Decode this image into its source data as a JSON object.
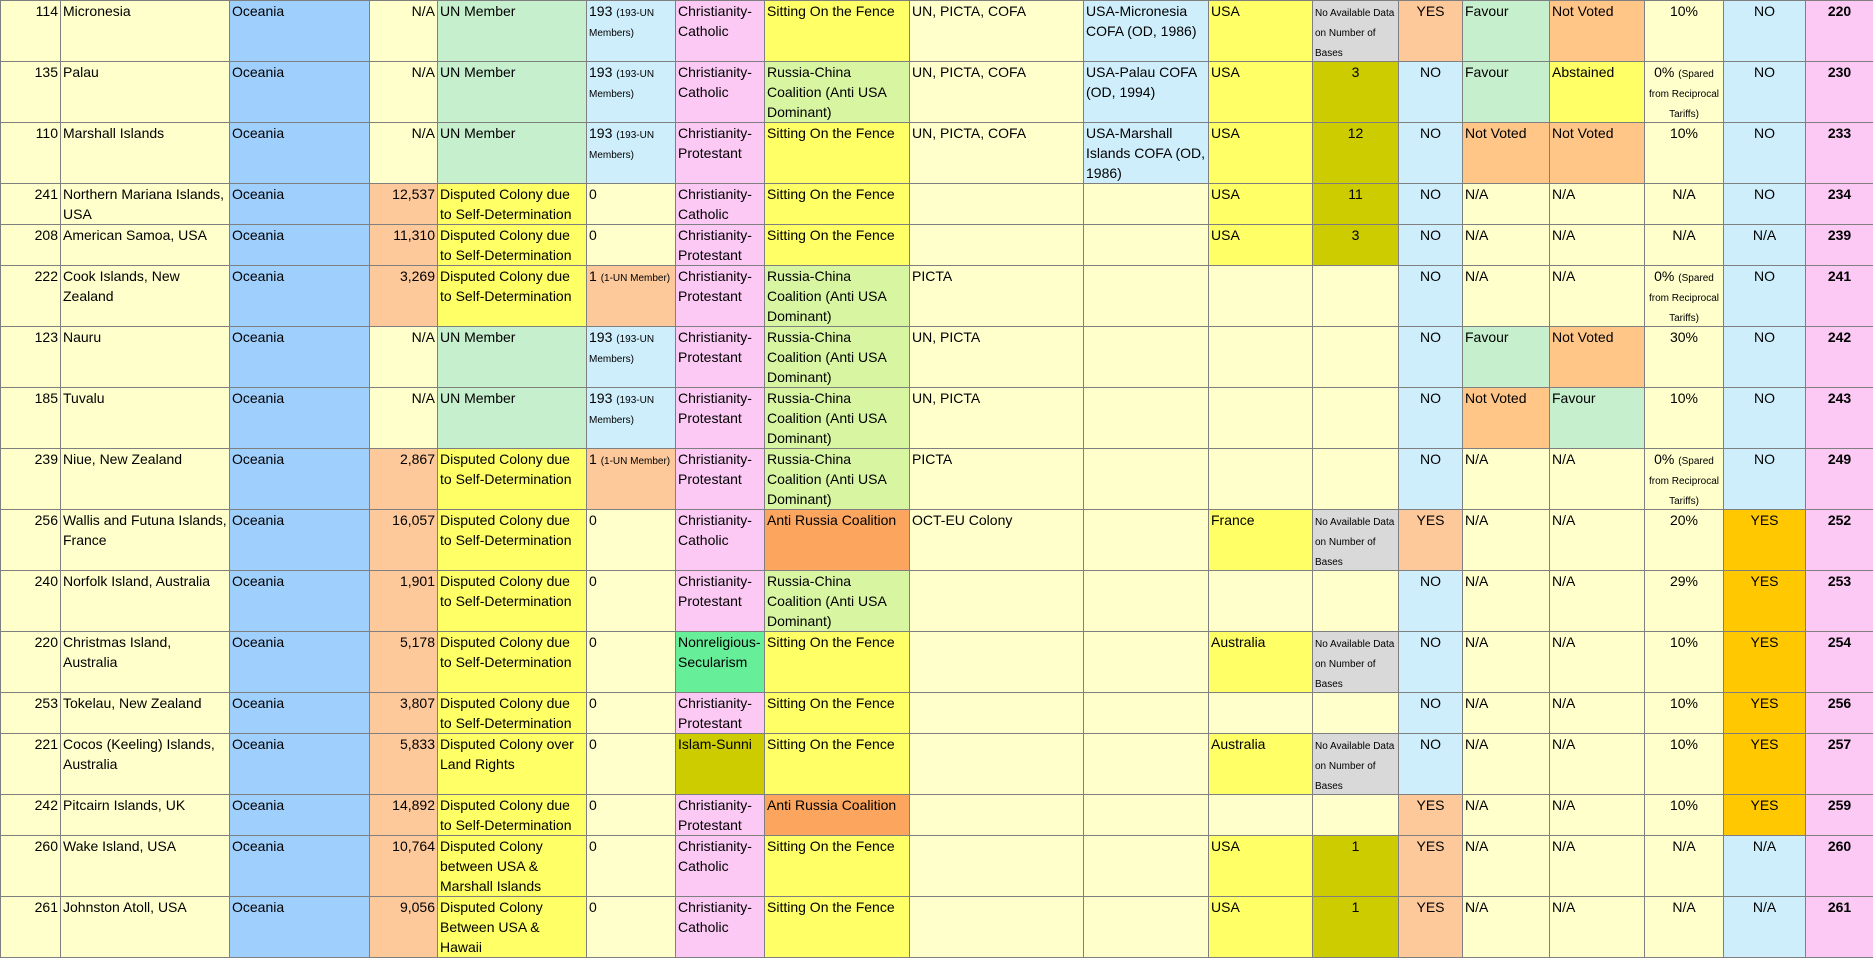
{
  "colors": {
    "pale_yellow": "#ffffcc",
    "region_blue": "#9fcffc",
    "peach": "#fdc99b",
    "green": "#c6efce",
    "light_blue": "#cfeefc",
    "pink": "#fcc9f5",
    "yellow": "#ffff66",
    "lime": "#d8f5a2",
    "orange": "#fba55f",
    "olive": "#cccc00",
    "mint": "#66ee99",
    "gray": "#d9d9d9",
    "gold": "#ffc800",
    "light_orange": "#ffc688"
  },
  "rows": [
    {
      "rank": "114",
      "name": "Micronesia",
      "region": "Oceania",
      "population": "N/A",
      "status": "UN Member",
      "un_count": "193",
      "un_note": "(193-UN Members)",
      "religion": "Christianity-Catholic",
      "alignment": "Sitting On the Fence",
      "orgs": "UN, PICTA, COFA",
      "agreement": "USA-Micronesia COFA (OD, 1986)",
      "host": "USA",
      "bases": "No Available Data on Number of Bases",
      "presence": "YES",
      "vote1": "Favour",
      "vote2": "Not Voted",
      "tariff": "10%",
      "tariff_note": "",
      "flag": "NO",
      "final_rank": "220"
    },
    {
      "rank": "135",
      "name": "Palau",
      "region": "Oceania",
      "population": "N/A",
      "status": "UN Member",
      "un_count": "193",
      "un_note": "(193-UN Members)",
      "religion": "Christianity-Catholic",
      "alignment": "Russia-China Coalition (Anti USA Dominant)",
      "orgs": "UN, PICTA, COFA",
      "agreement": "USA-Palau COFA (OD, 1994)",
      "host": "USA",
      "bases": "3",
      "presence": "NO",
      "vote1": "Favour",
      "vote2": "Abstained",
      "tariff": "0%",
      "tariff_note": "(Spared from Reciprocal Tariffs)",
      "flag": "NO",
      "final_rank": "230"
    },
    {
      "rank": "110",
      "name": "Marshall Islands",
      "region": "Oceania",
      "population": "N/A",
      "status": "UN Member",
      "un_count": "193",
      "un_note": "(193-UN Members)",
      "religion": "Christianity-Protestant",
      "alignment": "Sitting On the Fence",
      "orgs": "UN, PICTA, COFA",
      "agreement": "USA-Marshall Islands COFA (OD, 1986)",
      "host": "USA",
      "bases": "12",
      "presence": "NO",
      "vote1": "Not Voted",
      "vote2": "Not Voted",
      "tariff": "10%",
      "tariff_note": "",
      "flag": "NO",
      "final_rank": "233"
    },
    {
      "rank": "241",
      "name": "Northern Mariana Islands, USA",
      "region": "Oceania",
      "population": "12,537",
      "status": "Disputed Colony due to Self-Determination",
      "un_count": "0",
      "un_note": "",
      "religion": "Christianity-Catholic",
      "alignment": "Sitting On the Fence",
      "orgs": "",
      "agreement": "",
      "host": "USA",
      "bases": "11",
      "presence": "NO",
      "vote1": "N/A",
      "vote2": "N/A",
      "tariff": "N/A",
      "tariff_note": "",
      "flag": "NO",
      "final_rank": "234"
    },
    {
      "rank": "208",
      "name": "American Samoa, USA",
      "region": "Oceania",
      "population": "11,310",
      "status": "Disputed Colony due to Self-Determination",
      "un_count": "0",
      "un_note": "",
      "religion": "Christianity-Protestant",
      "alignment": "Sitting On the Fence",
      "orgs": "",
      "agreement": "",
      "host": "USA",
      "bases": "3",
      "presence": "NO",
      "vote1": "N/A",
      "vote2": "N/A",
      "tariff": "N/A",
      "tariff_note": "",
      "flag": "N/A",
      "final_rank": "239"
    },
    {
      "rank": "222",
      "name": "Cook Islands, New Zealand",
      "region": "Oceania",
      "population": "3,269",
      "status": "Disputed Colony due to Self-Determination",
      "un_count": "1",
      "un_note": "(1-UN Member)",
      "religion": "Christianity-Protestant",
      "alignment": "Russia-China Coalition (Anti USA Dominant)",
      "orgs": "PICTA",
      "agreement": "",
      "host": "",
      "bases": "",
      "presence": "NO",
      "vote1": "N/A",
      "vote2": "N/A",
      "tariff": "0%",
      "tariff_note": "(Spared from Reciprocal Tariffs)",
      "flag": "NO",
      "final_rank": "241"
    },
    {
      "rank": "123",
      "name": "Nauru",
      "region": "Oceania",
      "population": "N/A",
      "status": "UN Member",
      "un_count": "193",
      "un_note": "(193-UN Members)",
      "religion": "Christianity-Protestant",
      "alignment": "Russia-China Coalition (Anti USA Dominant)",
      "orgs": "UN, PICTA",
      "agreement": "",
      "host": "",
      "bases": "",
      "presence": "NO",
      "vote1": "Favour",
      "vote2": "Not Voted",
      "tariff": "30%",
      "tariff_note": "",
      "flag": "NO",
      "final_rank": "242"
    },
    {
      "rank": "185",
      "name": "Tuvalu",
      "region": "Oceania",
      "population": "N/A",
      "status": "UN Member",
      "un_count": "193",
      "un_note": "(193-UN Members)",
      "religion": "Christianity-Protestant",
      "alignment": "Russia-China Coalition (Anti USA Dominant)",
      "orgs": "UN, PICTA",
      "agreement": "",
      "host": "",
      "bases": "",
      "presence": "NO",
      "vote1": "Not Voted",
      "vote2": "Favour",
      "tariff": "10%",
      "tariff_note": "",
      "flag": "NO",
      "final_rank": "243"
    },
    {
      "rank": "239",
      "name": "Niue, New Zealand",
      "region": "Oceania",
      "population": "2,867",
      "status": "Disputed Colony due to Self-Determination",
      "un_count": "1",
      "un_note": "(1-UN Member)",
      "religion": "Christianity-Protestant",
      "alignment": "Russia-China Coalition (Anti USA Dominant)",
      "orgs": "PICTA",
      "agreement": "",
      "host": "",
      "bases": "",
      "presence": "NO",
      "vote1": "N/A",
      "vote2": "N/A",
      "tariff": "0%",
      "tariff_note": "(Spared from Reciprocal Tariffs)",
      "flag": "NO",
      "final_rank": "249"
    },
    {
      "rank": "256",
      "name": "Wallis and Futuna Islands, France",
      "region": "Oceania",
      "population": "16,057",
      "status": "Disputed Colony due to Self-Determination",
      "un_count": "0",
      "un_note": "",
      "religion": "Christianity-Catholic",
      "alignment": "Anti Russia Coalition",
      "orgs": "OCT-EU Colony",
      "agreement": "",
      "host": "France",
      "bases": "No Available Data on Number of Bases",
      "presence": "YES",
      "vote1": "N/A",
      "vote2": "N/A",
      "tariff": "20%",
      "tariff_note": "",
      "flag": "YES",
      "final_rank": "252"
    },
    {
      "rank": "240",
      "name": "Norfolk Island, Australia",
      "region": "Oceania",
      "population": "1,901",
      "status": "Disputed Colony due to Self-Determination",
      "un_count": "0",
      "un_note": "",
      "religion": "Christianity-Protestant",
      "alignment": "Russia-China Coalition (Anti USA Dominant)",
      "orgs": "",
      "agreement": "",
      "host": "",
      "bases": "",
      "presence": "NO",
      "vote1": "N/A",
      "vote2": "N/A",
      "tariff": "29%",
      "tariff_note": "",
      "flag": "YES",
      "final_rank": "253"
    },
    {
      "rank": "220",
      "name": "Christmas Island, Australia",
      "region": "Oceania",
      "population": "5,178",
      "status": "Disputed Colony due to Self-Determination",
      "un_count": "0",
      "un_note": "",
      "religion": "Nonreligious-Secularism",
      "alignment": "Sitting On the Fence",
      "orgs": "",
      "agreement": "",
      "host": "Australia",
      "bases": "No Available Data on Number of Bases",
      "presence": "NO",
      "vote1": "N/A",
      "vote2": "N/A",
      "tariff": "10%",
      "tariff_note": "",
      "flag": "YES",
      "final_rank": "254"
    },
    {
      "rank": "253",
      "name": "Tokelau, New Zealand",
      "region": "Oceania",
      "population": "3,807",
      "status": "Disputed Colony due to Self-Determination",
      "un_count": "0",
      "un_note": "",
      "religion": "Christianity-Protestant",
      "alignment": "Sitting On the Fence",
      "orgs": "",
      "agreement": "",
      "host": "",
      "bases": "",
      "presence": "NO",
      "vote1": "N/A",
      "vote2": "N/A",
      "tariff": "10%",
      "tariff_note": "",
      "flag": "YES",
      "final_rank": "256"
    },
    {
      "rank": "221",
      "name": "Cocos (Keeling) Islands, Australia",
      "region": "Oceania",
      "population": "5,833",
      "status": "Disputed Colony over Land Rights",
      "un_count": "0",
      "un_note": "",
      "religion": "Islam-Sunni",
      "alignment": "Sitting On the Fence",
      "orgs": "",
      "agreement": "",
      "host": "Australia",
      "bases": "No Available Data on Number of Bases",
      "presence": "NO",
      "vote1": "N/A",
      "vote2": "N/A",
      "tariff": "10%",
      "tariff_note": "",
      "flag": "YES",
      "final_rank": "257"
    },
    {
      "rank": "242",
      "name": "Pitcairn Islands, UK",
      "region": "Oceania",
      "population": "14,892",
      "status": "Disputed Colony due to Self-Determination",
      "un_count": "0",
      "un_note": "",
      "religion": "Christianity-Protestant",
      "alignment": "Anti Russia Coalition",
      "orgs": "",
      "agreement": "",
      "host": "",
      "bases": "",
      "presence": "YES",
      "vote1": "N/A",
      "vote2": "N/A",
      "tariff": "10%",
      "tariff_note": "",
      "flag": "YES",
      "final_rank": "259"
    },
    {
      "rank": "260",
      "name": "Wake Island, USA",
      "region": "Oceania",
      "population": "10,764",
      "status": "Disputed Colony between USA & Marshall Islands",
      "un_count": "0",
      "un_note": "",
      "religion": "Christianity-Catholic",
      "alignment": "Sitting On the Fence",
      "orgs": "",
      "agreement": "",
      "host": "USA",
      "bases": "1",
      "presence": "YES",
      "vote1": "N/A",
      "vote2": "N/A",
      "tariff": "N/A",
      "tariff_note": "",
      "flag": "N/A",
      "final_rank": "260"
    },
    {
      "rank": "261",
      "name": "Johnston Atoll, USA",
      "region": "Oceania",
      "population": "9,056",
      "status": "Disputed Colony Between USA & Hawaii",
      "un_count": "0",
      "un_note": "",
      "religion": "Christianity-Catholic",
      "alignment": "Sitting On the Fence",
      "orgs": "",
      "agreement": "",
      "host": "USA",
      "bases": "1",
      "presence": "YES",
      "vote1": "N/A",
      "vote2": "N/A",
      "tariff": "N/A",
      "tariff_note": "",
      "flag": "N/A",
      "final_rank": "261"
    }
  ]
}
